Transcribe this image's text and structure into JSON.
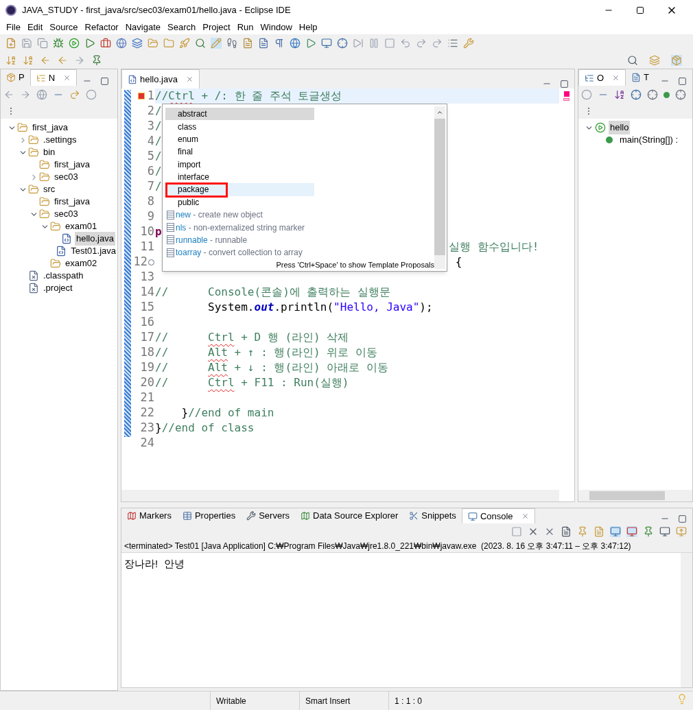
{
  "window": {
    "title": "JAVA_STUDY - first_java/src/sec03/exam01/hello.java - Eclipse IDE"
  },
  "menu": [
    "File",
    "Edit",
    "Source",
    "Refactor",
    "Navigate",
    "Search",
    "Project",
    "Run",
    "Window",
    "Help"
  ],
  "left_panel": {
    "tabs": [
      {
        "label": "P",
        "selected": false
      },
      {
        "label": "N",
        "selected": true
      }
    ],
    "tree": [
      {
        "label": "first_java",
        "kind": "project",
        "expanded": true,
        "selected": false,
        "children": [
          {
            "label": ".settings",
            "kind": "folder",
            "expanded": false,
            "selected": false
          },
          {
            "label": "bin",
            "kind": "folder",
            "expanded": true,
            "selected": false,
            "children": [
              {
                "label": "first_java",
                "kind": "folder",
                "selected": false
              },
              {
                "label": "sec03",
                "kind": "folder",
                "expanded": false,
                "selected": false
              }
            ]
          },
          {
            "label": "src",
            "kind": "folder",
            "expanded": true,
            "selected": false,
            "children": [
              {
                "label": "first_java",
                "kind": "folder",
                "selected": false
              },
              {
                "label": "sec03",
                "kind": "folder",
                "expanded": true,
                "selected": false,
                "children": [
                  {
                    "label": "exam01",
                    "kind": "folder",
                    "expanded": true,
                    "selected": false,
                    "children": [
                      {
                        "label": "hello.java",
                        "kind": "java",
                        "selected": true
                      },
                      {
                        "label": "Test01.java",
                        "kind": "java",
                        "selected": false
                      }
                    ]
                  },
                  {
                    "label": "exam02",
                    "kind": "folder",
                    "selected": false
                  }
                ]
              }
            ]
          },
          {
            "label": ".classpath",
            "kind": "xml",
            "selected": false
          },
          {
            "label": ".project",
            "kind": "xml",
            "selected": false
          }
        ]
      }
    ]
  },
  "editor": {
    "tab": {
      "label": "hello.java",
      "selected": true
    },
    "lines": [
      {
        "number": "1",
        "current": true,
        "segments": [
          {
            "kind": "comment",
            "text": "//"
          },
          {
            "kind": "comment",
            "text": "Ctrl",
            "misspelled": true
          },
          {
            "kind": "comment",
            "text": " + /: 한 줄 주석 토글생성"
          }
        ]
      },
      {
        "number": "2",
        "segments": [
          {
            "kind": "comment",
            "text": "/"
          }
        ]
      },
      {
        "number": "3",
        "segments": [
          {
            "kind": "comment",
            "text": "/"
          }
        ]
      },
      {
        "number": "4",
        "segments": [
          {
            "kind": "comment",
            "text": "/"
          }
        ]
      },
      {
        "number": "5",
        "segments": [
          {
            "kind": "comment",
            "text": "/"
          }
        ]
      },
      {
        "number": "6",
        "segments": [
          {
            "kind": "comment",
            "text": "/"
          }
        ]
      },
      {
        "number": "7",
        "segments": [
          {
            "kind": "comment",
            "text": "/"
          }
        ]
      },
      {
        "number": "8"
      },
      {
        "number": "9"
      },
      {
        "number": "10",
        "segments": [
          {
            "kind": "keyword",
            "text": "p"
          }
        ]
      },
      {
        "number": "11",
        "after_popup": [
          {
            "kind": "comment",
            "text": "실행 함수입니다!"
          }
        ]
      },
      {
        "number": "12",
        "folding": true,
        "after_popup": [
          {
            "kind": "plain",
            "text": " {"
          }
        ]
      },
      {
        "number": "13"
      },
      {
        "number": "14",
        "segments": [
          {
            "kind": "comment",
            "text": "//      Console(콘솔)에 출력하는 실행문"
          }
        ]
      },
      {
        "number": "15",
        "segments": [
          {
            "kind": "plain",
            "text": "        System."
          },
          {
            "kind": "field",
            "text": "out"
          },
          {
            "kind": "plain",
            "text": ".println("
          },
          {
            "kind": "string",
            "text": "\"Hello, Java\""
          },
          {
            "kind": "plain",
            "text": ");"
          }
        ]
      },
      {
        "number": "16"
      },
      {
        "number": "17",
        "segments": [
          {
            "kind": "comment",
            "text": "//      "
          },
          {
            "kind": "comment",
            "text": "Ctrl",
            "misspelled": true
          },
          {
            "kind": "comment",
            "text": " + D 행 (라인) 삭제"
          }
        ]
      },
      {
        "number": "18",
        "segments": [
          {
            "kind": "comment",
            "text": "//      "
          },
          {
            "kind": "comment",
            "text": "Alt",
            "misspelled": true
          },
          {
            "kind": "comment",
            "text": " + ↑ : 행(라인) 위로 이동"
          }
        ]
      },
      {
        "number": "19",
        "segments": [
          {
            "kind": "comment",
            "text": "//      "
          },
          {
            "kind": "comment",
            "text": "Alt",
            "misspelled": true
          },
          {
            "kind": "comment",
            "text": " + ↓ : 행(라인) 아래로 이동"
          }
        ]
      },
      {
        "number": "20",
        "segments": [
          {
            "kind": "comment",
            "text": "//      "
          },
          {
            "kind": "comment",
            "text": "Ctrl",
            "misspelled": true
          },
          {
            "kind": "comment",
            "text": " + F11 : Run(실행)"
          }
        ]
      },
      {
        "number": "21"
      },
      {
        "number": "22",
        "segments": [
          {
            "kind": "plain",
            "text": "    }"
          },
          {
            "kind": "comment",
            "text": "//end of main"
          }
        ]
      },
      {
        "number": "23",
        "segments": [
          {
            "kind": "plain",
            "text": "}"
          },
          {
            "kind": "comment",
            "text": "//end of class"
          }
        ]
      },
      {
        "number": "24"
      }
    ],
    "completion": {
      "items": [
        {
          "kind": "keyword",
          "label": "abstract",
          "selected": true,
          "hovered": false,
          "annotated": false
        },
        {
          "kind": "keyword",
          "label": "class",
          "selected": false,
          "hovered": false,
          "annotated": false
        },
        {
          "kind": "keyword",
          "label": "enum",
          "selected": false,
          "hovered": false,
          "annotated": false
        },
        {
          "kind": "keyword",
          "label": "final",
          "selected": false,
          "hovered": false,
          "annotated": false
        },
        {
          "kind": "keyword",
          "label": "import",
          "selected": false,
          "hovered": false,
          "annotated": false
        },
        {
          "kind": "keyword",
          "label": "interface",
          "selected": false,
          "hovered": false,
          "annotated": false
        },
        {
          "kind": "keyword",
          "label": "package",
          "selected": false,
          "hovered": true,
          "annotated": true
        },
        {
          "kind": "keyword",
          "label": "public",
          "selected": false,
          "hovered": false,
          "annotated": false
        },
        {
          "kind": "template",
          "label": "new",
          "description": " - create new object",
          "selected": false,
          "hovered": false,
          "annotated": false
        },
        {
          "kind": "template",
          "label": "nls",
          "description": " - non-externalized string marker",
          "selected": false,
          "hovered": false,
          "annotated": false
        },
        {
          "kind": "template",
          "label": "runnable",
          "description": " - runnable",
          "selected": false,
          "hovered": false,
          "annotated": false
        },
        {
          "kind": "template",
          "label": "toarray",
          "description": " - convert collection to array",
          "selected": false,
          "hovered": false,
          "annotated": false
        }
      ],
      "hint": "Press 'Ctrl+Space' to show Template Proposals"
    }
  },
  "outline": {
    "tabs": [
      {
        "label": "O",
        "selected": true
      },
      {
        "label": "T",
        "selected": false
      }
    ],
    "tree": [
      {
        "label": "hello",
        "kind": "class",
        "selected": true,
        "expanded": true,
        "children": [
          {
            "label": "main(String[]) :",
            "kind": "method",
            "selected": false
          }
        ]
      }
    ]
  },
  "bottom": {
    "tabs": [
      {
        "label": "Markers",
        "selected": false
      },
      {
        "label": "Properties",
        "selected": false
      },
      {
        "label": "Servers",
        "selected": false
      },
      {
        "label": "Data Source Explorer",
        "selected": false
      },
      {
        "label": "Snippets",
        "selected": false
      },
      {
        "label": "Console",
        "selected": true
      }
    ],
    "header": "<terminated> Test01 [Java Application] C:₩Program Files₩Java₩jre1.8.0_221₩bin₩javaw.exe  (2023. 8. 16 오후 3:47:11 – 오후 3:47:12)",
    "output": "장나라!  안녕"
  },
  "status_bar": [
    "Writable",
    "Smart Insert",
    "1 : 1 : 0"
  ]
}
